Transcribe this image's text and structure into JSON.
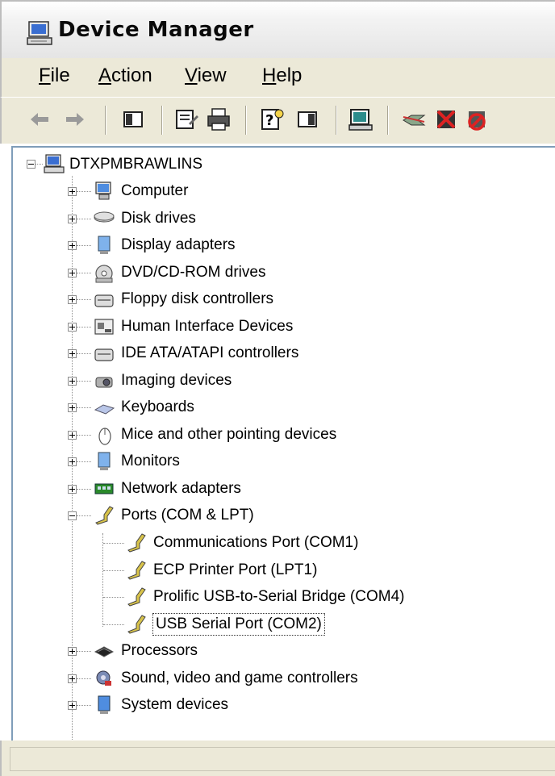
{
  "window": {
    "title": "Device Manager"
  },
  "menu": [
    {
      "label": "File",
      "mnemonic": "F",
      "rest": "ile"
    },
    {
      "label": "Action",
      "mnemonic": "A",
      "rest": "ction"
    },
    {
      "label": "View",
      "mnemonic": "V",
      "rest": "iew"
    },
    {
      "label": "Help",
      "mnemonic": "H",
      "rest": "elp"
    }
  ],
  "toolbar": {
    "buttons": [
      "back-icon",
      "forward-icon",
      "show-hide-tree-icon",
      "properties-icon",
      "print-icon",
      "help-icon",
      "show-hide-action-pane-icon",
      "scan-hardware-icon",
      "update-driver-icon",
      "uninstall-icon",
      "disable-icon"
    ]
  },
  "tree": {
    "root": "DTXPMBRAWLINS",
    "categories": [
      "Computer",
      "Disk drives",
      "Display adapters",
      "DVD/CD-ROM drives",
      "Floppy disk controllers",
      "Human Interface Devices",
      "IDE ATA/ATAPI controllers",
      "Imaging devices",
      "Keyboards",
      "Mice and other pointing devices",
      "Monitors",
      "Network adapters",
      "Ports (COM & LPT)"
    ],
    "ports_children": [
      "Communications Port (COM1)",
      "ECP Printer Port (LPT1)",
      "Prolific USB-to-Serial Bridge (COM4)",
      "USB Serial Port (COM2)"
    ],
    "after_ports": [
      "Processors",
      "Sound, video and game controllers",
      "System devices"
    ],
    "selected": "USB Serial Port (COM2)"
  },
  "colors": {
    "accent_blue": "#3b6cc7",
    "toolbar_bg": "#ece9d8",
    "tree_border": "#7f9db9"
  }
}
